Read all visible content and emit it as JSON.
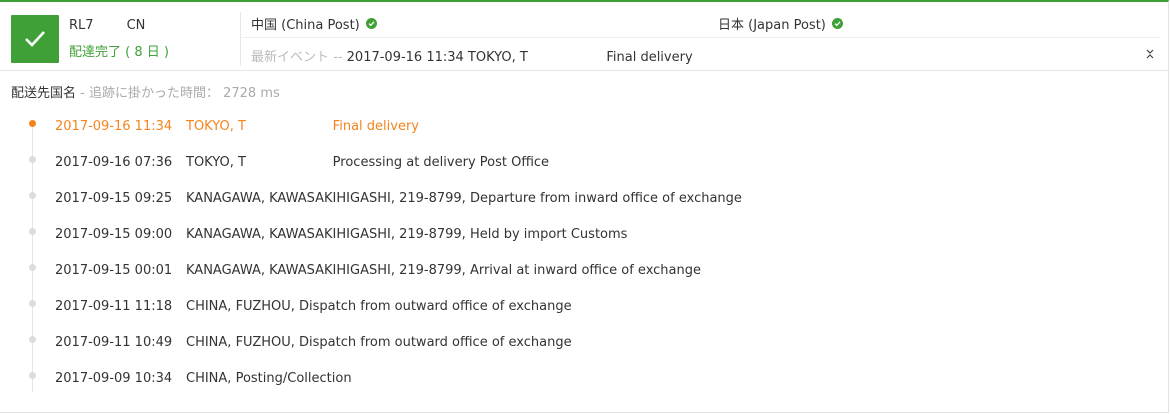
{
  "header": {
    "tracking_number": "RL7        CN",
    "status": "配達完了 ( 8 日 )",
    "origin_carrier": "中国 (China Post)",
    "destination_carrier": "日本 (Japan Post)",
    "latest_label": "最新イベント -- ",
    "latest_event": "2017-09-16 11:34 TOKYO, T                   Final delivery",
    "expand_icon": "x",
    "colors": {
      "accent": "#3fa037",
      "current": "#f5841f"
    }
  },
  "destination": {
    "name": "配送先国名",
    "time_text": " - 追跡に掛かった時間： 2728 ms"
  },
  "events": [
    {
      "time": "2017-09-16 11:34",
      "desc": "TOKYO, T                     Final delivery"
    },
    {
      "time": "2017-09-16 07:36",
      "desc": "TOKYO, T                     Processing at delivery Post Office"
    },
    {
      "time": "2017-09-15 09:25",
      "desc": "KANAGAWA, KAWASAKIHIGASHI, 219-8799, Departure from inward office of exchange"
    },
    {
      "time": "2017-09-15 09:00",
      "desc": "KANAGAWA, KAWASAKIHIGASHI, 219-8799, Held by import Customs"
    },
    {
      "time": "2017-09-15 00:01",
      "desc": "KANAGAWA, KAWASAKIHIGASHI, 219-8799, Arrival at inward office of exchange"
    },
    {
      "time": "2017-09-11 11:18",
      "desc": "CHINA, FUZHOU, Dispatch from outward office of exchange"
    },
    {
      "time": "2017-09-11 10:49",
      "desc": "CHINA, FUZHOU, Dispatch from outward office of exchange"
    },
    {
      "time": "2017-09-09 10:34",
      "desc": "CHINA, Posting/Collection"
    }
  ]
}
